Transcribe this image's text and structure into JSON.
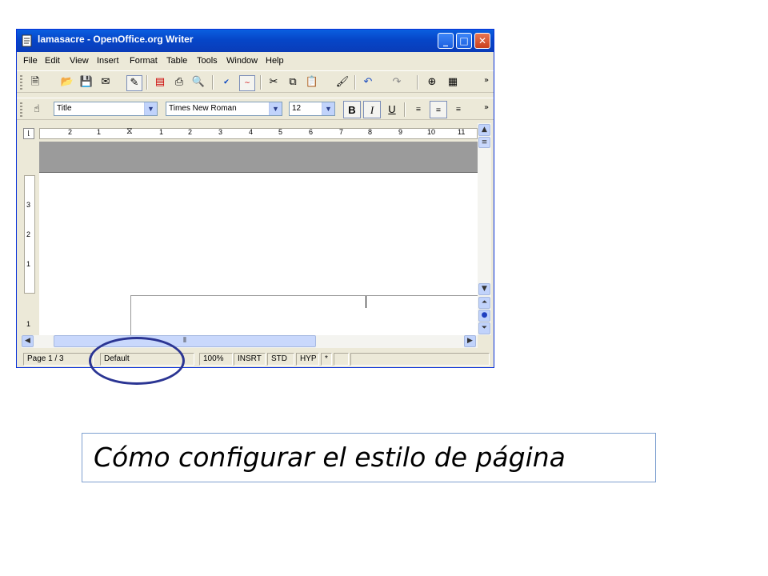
{
  "window": {
    "title": "lamasacre - OpenOffice.org Writer",
    "buttons": {
      "minimize": "_",
      "maximize": "□",
      "close": "✕"
    }
  },
  "menu": [
    "File",
    "Edit",
    "View",
    "Insert",
    "Format",
    "Table",
    "Tools",
    "Window",
    "Help"
  ],
  "formatting": {
    "paragraph_style": "Title",
    "font_name": "Times New Roman",
    "font_size": "12",
    "bold": "B",
    "italic": "I",
    "underline": "U"
  },
  "ruler": {
    "horizontal_labels": [
      "2",
      "1",
      "1",
      "2",
      "3",
      "4",
      "5",
      "6",
      "7",
      "8",
      "9",
      "10",
      "11"
    ],
    "vertical_labels": [
      "3",
      "2",
      "1",
      "1"
    ]
  },
  "status": {
    "page": "Page 1 / 3",
    "page_style": "Default",
    "zoom": "100%",
    "insert_mode": "INSRT",
    "selection_mode": "STD",
    "hyphenation": "HYP",
    "modified": "*"
  },
  "caption": "Cómo configurar el estilo de página",
  "colors": {
    "titlebar": "#0a5fe0",
    "highlight_circle": "#2b3593",
    "caption_border": "#7ea0d0"
  }
}
